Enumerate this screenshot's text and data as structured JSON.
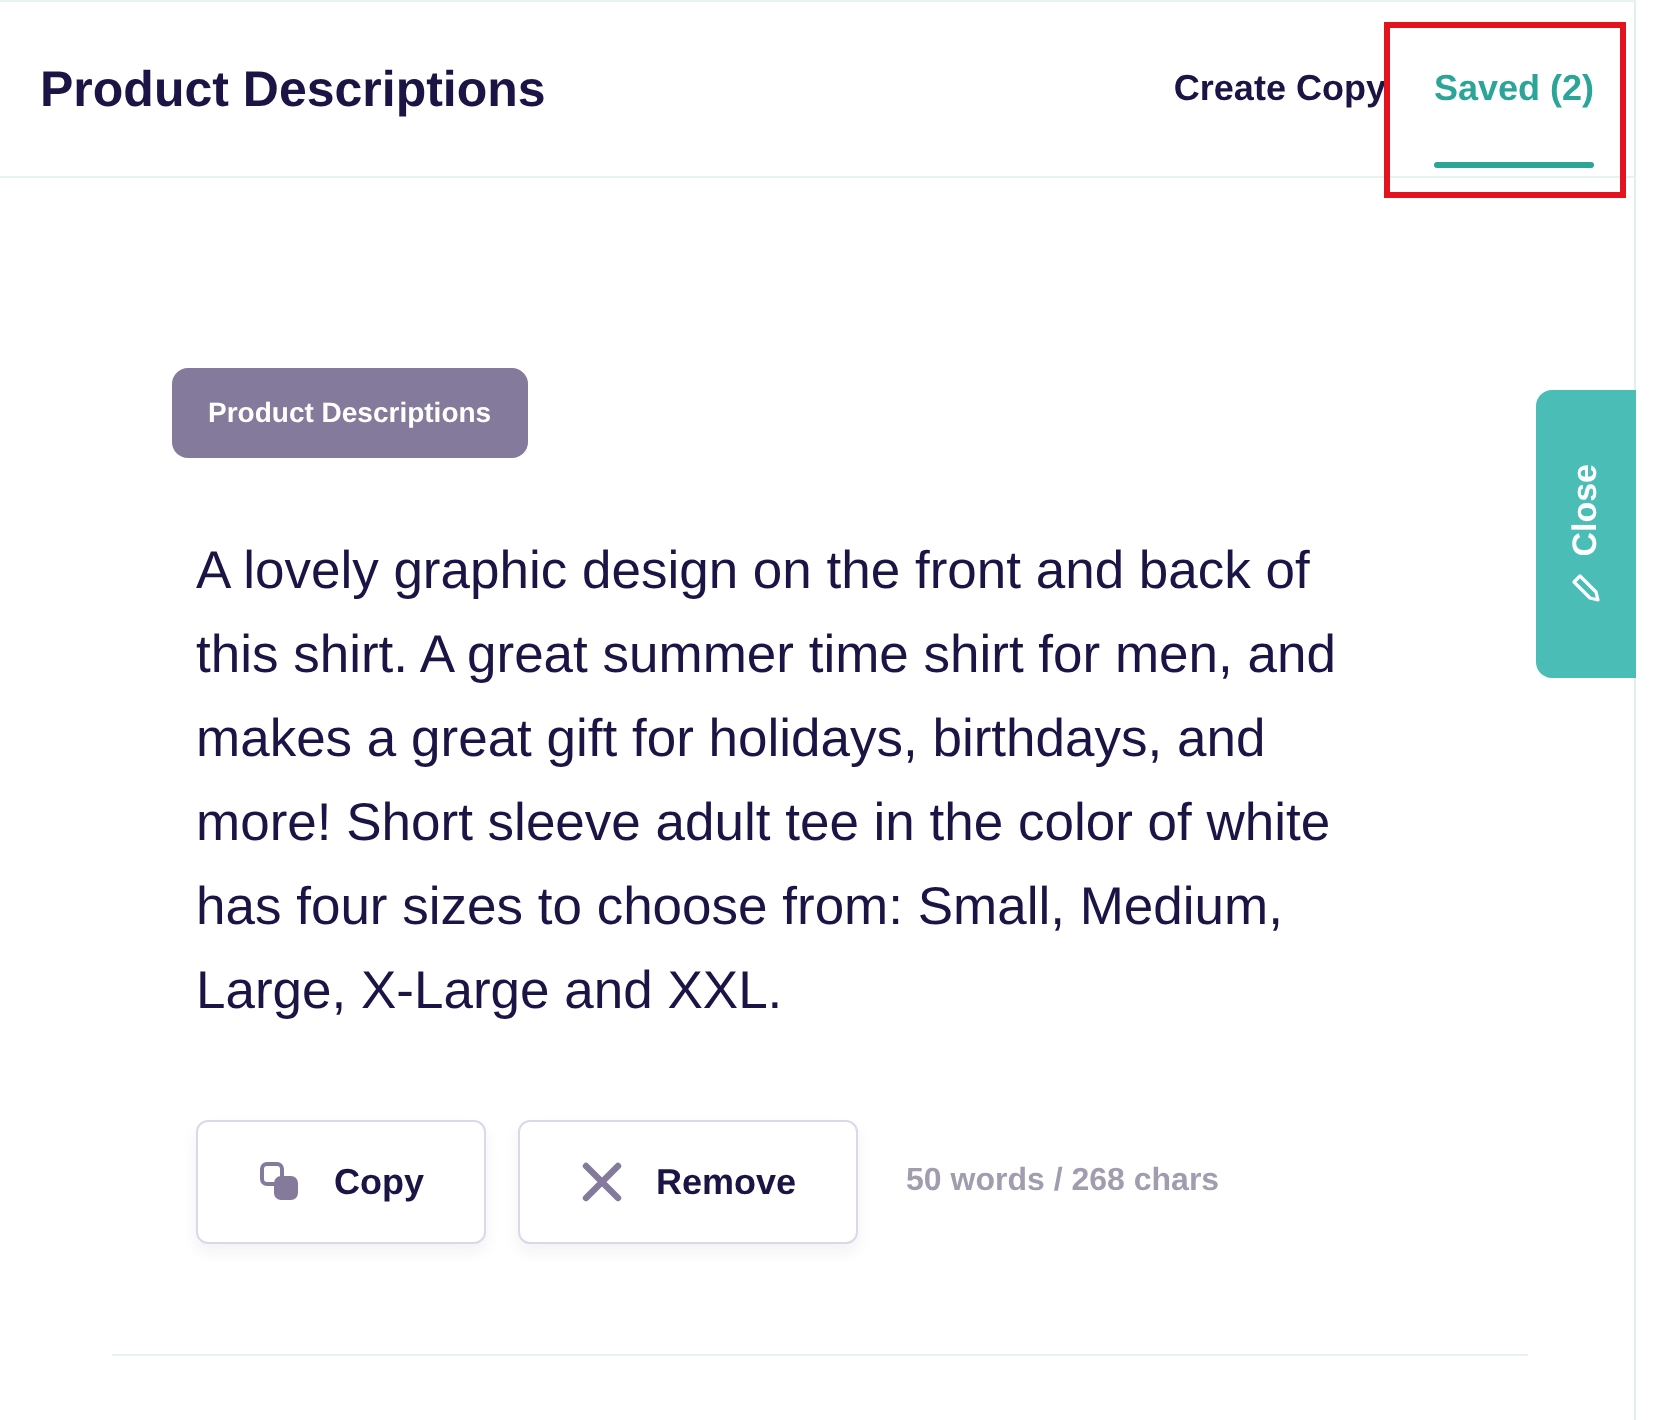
{
  "header": {
    "title": "Product Descriptions"
  },
  "tabs": [
    {
      "label": "Create Copy",
      "selected": false,
      "highlighted": false
    },
    {
      "label": "Saved (2)",
      "selected": true,
      "highlighted": true
    }
  ],
  "saved_item": {
    "tag": "Product Descriptions",
    "text": "A lovely graphic design on the front and back of this shirt. A great summer time shirt for men, and makes a great gift for holidays, birthdays, and more! Short sleeve adult tee in the color of white has four sizes to choose from: Small, Medium, Large, X-Large and XXL.",
    "buttons": [
      {
        "kind": "copy",
        "label": "Copy"
      },
      {
        "kind": "remove",
        "label": "Remove"
      }
    ],
    "stats": "50 words / 268 chars"
  },
  "side_tab": {
    "label": "Close"
  }
}
